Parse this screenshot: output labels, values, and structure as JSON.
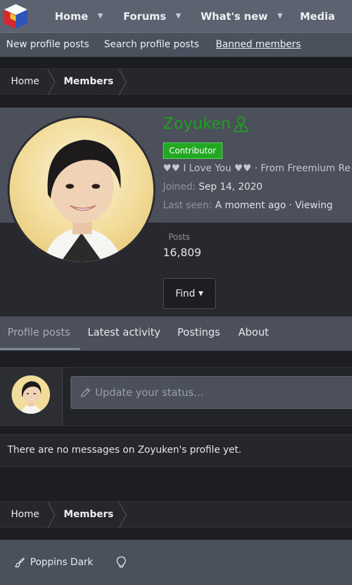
{
  "topnav": {
    "tabs": [
      {
        "label": "Home"
      },
      {
        "label": "Forums"
      },
      {
        "label": "What's new"
      },
      {
        "label": "Media"
      }
    ]
  },
  "subnav": {
    "links": [
      {
        "label": "New profile posts"
      },
      {
        "label": "Search profile posts"
      },
      {
        "label": "Banned members"
      }
    ]
  },
  "breadcrumb": {
    "items": [
      {
        "label": "Home"
      },
      {
        "label": "Members"
      }
    ]
  },
  "profile": {
    "username": "Zoyuken",
    "badge": "Contributor",
    "tagline": "♥♥ I Love You ♥♥ · From Freemium Re",
    "joined_label": "Joined:",
    "joined_value": "Sep 14, 2020",
    "last_seen_label": "Last seen:",
    "last_seen_value": "A moment ago · Viewing",
    "posts_label": "Posts",
    "posts_value": "16,809",
    "find_label": "Find",
    "username_color": "#1ea01e",
    "badge_color": "#23a823"
  },
  "tabs": [
    {
      "label": "Profile posts",
      "active": true
    },
    {
      "label": "Latest activity"
    },
    {
      "label": "Postings"
    },
    {
      "label": "About"
    }
  ],
  "status": {
    "placeholder": "Update your status..."
  },
  "empty_message": "There are no messages on Zoyuken's profile yet.",
  "footer": {
    "style_label": "Poppins Dark"
  }
}
